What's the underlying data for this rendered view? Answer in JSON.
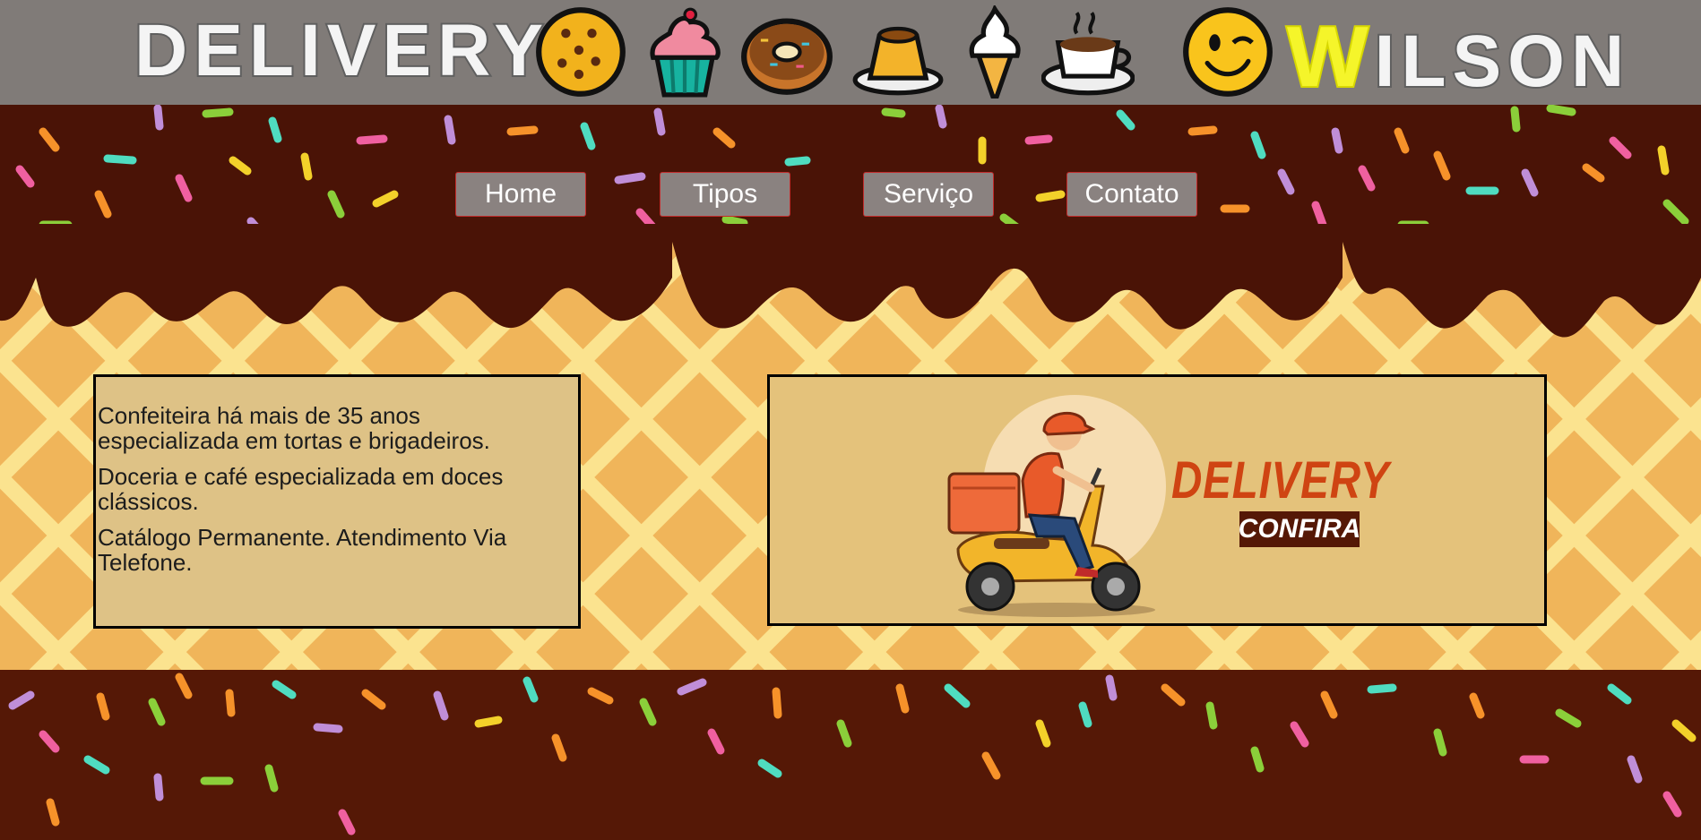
{
  "header": {
    "left_brand": "DELIVERY",
    "right_brand_cap": "W",
    "right_brand_rest": "ILSON",
    "icons": [
      "cookie-icon",
      "cupcake-icon",
      "donut-icon",
      "pudding-icon",
      "ice-cream-icon",
      "coffee-icon",
      "winking-face-icon"
    ]
  },
  "nav": {
    "items": [
      {
        "label": "Home"
      },
      {
        "label": "Tipos"
      },
      {
        "label": "Serviço"
      },
      {
        "label": "Contato"
      }
    ]
  },
  "info": {
    "p1": "Confeiteira há mais de 35 anos especializada em tortas e brigadeiros.",
    "p2": "Doceria e café especializada em doces clássicos.",
    "p3": "Catálogo Permanente. Atendimento Via Telefone."
  },
  "promo": {
    "title": "DELIVERY",
    "cta": "CONFIRA"
  },
  "colors": {
    "header_bg": "#807b78",
    "chocolate": "#4a1306",
    "waffle": "#f6c66a",
    "nav_bg": "#8a8280",
    "nav_border": "#c32b2b",
    "info_bg": "#dec286",
    "promo_bg": "#e4c27b",
    "promo_title": "#cf4412"
  }
}
